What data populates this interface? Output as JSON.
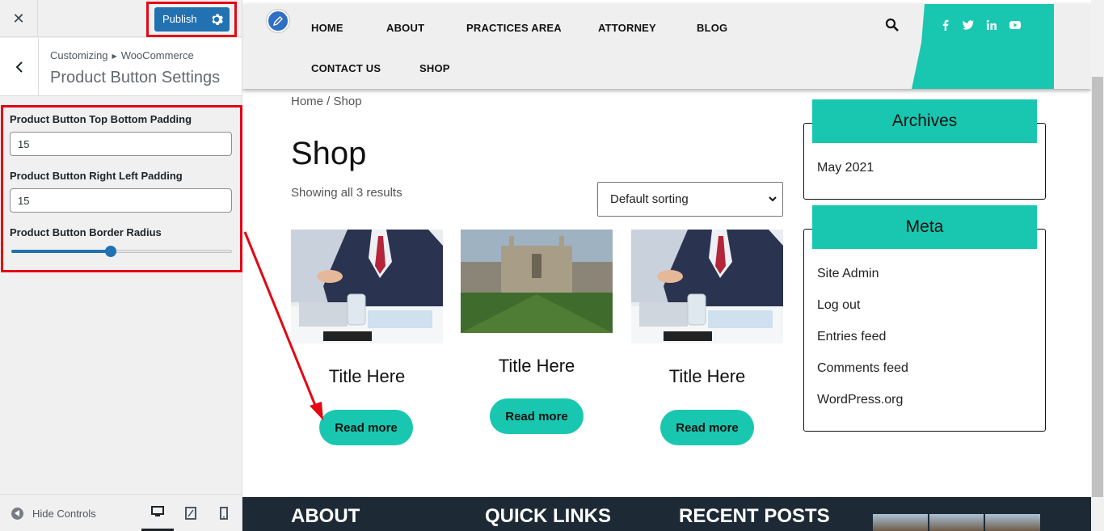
{
  "customizer": {
    "publish_label": "Publish",
    "breadcrumb": [
      "Customizing",
      "WooCommerce"
    ],
    "section_title": "Product Button Settings",
    "controls": {
      "top_bottom_label": "Product Button Top Bottom Padding",
      "top_bottom_value": "15",
      "right_left_label": "Product Button Right Left Padding",
      "right_left_value": "15",
      "border_radius_label": "Product Button Border Radius",
      "border_radius_fraction": 0.45
    },
    "hide_controls_label": "Hide Controls",
    "devices": [
      "desktop-icon",
      "tablet-icon",
      "mobile-icon"
    ]
  },
  "site": {
    "nav": [
      "HOME",
      "ABOUT",
      "PRACTICES AREA",
      "ATTORNEY",
      "BLOG",
      "CONTACT US",
      "SHOP"
    ],
    "social_icons": [
      "facebook-icon",
      "twitter-icon",
      "linkedin-icon",
      "youtube-icon"
    ],
    "breadcrumb": "Home / Shop",
    "page_title": "Shop",
    "result_count": "Showing all 3 results",
    "sort_value": "Default sorting",
    "products": [
      {
        "title": "Title Here",
        "button": "Read more",
        "image": "businessman-photo"
      },
      {
        "title": "Title Here",
        "button": "Read more",
        "image": "college-building-photo"
      },
      {
        "title": "Title Here",
        "button": "Read more",
        "image": "businessman-photo"
      }
    ],
    "archives": {
      "title": "Archives",
      "links": [
        "May 2021"
      ]
    },
    "meta": {
      "title": "Meta",
      "links": [
        "Site Admin",
        "Log out",
        "Entries feed",
        "Comments feed",
        "WordPress.org"
      ]
    },
    "footer_headings": [
      "ABOUT",
      "QUICK LINKS",
      "RECENT POSTS"
    ]
  },
  "colors": {
    "accent": "#19c7b0",
    "publish": "#2271b1",
    "annotation": "#e30613",
    "footer": "#1d2a36"
  }
}
